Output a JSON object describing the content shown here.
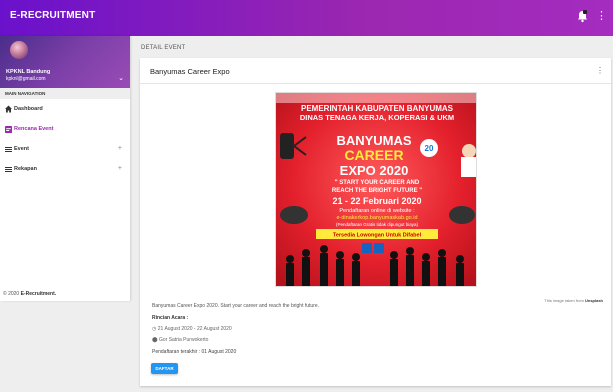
{
  "app": {
    "title": "E-RECRUITMENT"
  },
  "topbar": {
    "notification_icon": "bell-icon",
    "menu_icon": "kebab-icon"
  },
  "sidebar": {
    "user": {
      "name": "KPKNL Bandung",
      "email": "kpknl@gmail.com"
    },
    "nav_header": "MAIN NAVIGATION",
    "items": [
      {
        "label": "Dashboard",
        "icon": "home-icon",
        "active": false
      },
      {
        "label": "Rencana Event",
        "icon": "calendar-icon",
        "active": true
      },
      {
        "label": "Event",
        "icon": "list-icon",
        "expand": "+"
      },
      {
        "label": "Rekapan",
        "icon": "list-icon",
        "expand": "+"
      }
    ],
    "footer": {
      "year_text": "© 2020",
      "brand": "E-Recruitment."
    }
  },
  "breadcrumb": "DETAIL EVENT",
  "event": {
    "title": "Banyumas Career Expo",
    "poster": {
      "line1": "PEMERINTAH KABUPATEN BANYUMAS",
      "line2": "DINAS TENAGA KERJA, KOPERASI & UKM",
      "headline1": "BANYUMAS",
      "headline2": "CAREER",
      "headline3": "EXPO 2020",
      "tagline1": "\" START YOUR CAREER AND",
      "tagline2": "REACH THE BRIGHT FUTURE \"",
      "dates": "21 - 22 Februari 2020",
      "reg1": "Pendaftaran online di website :",
      "reg2": "e-dinakerkop.banyumaskab.go.id",
      "reg3": "(Pendaftaran Gratis tidak dipungut biaya)",
      "banner": "Tersedia Lowongan Untuk Difabel",
      "badge": "20"
    },
    "image_credit_prefix": "This image taken from ",
    "image_credit_source": "Unsplash",
    "description": "Banyumas Career Expo 2020. Start your career and reach the bright future.",
    "rincian_label": "Rincian Acara :",
    "date_range": "21 August 2020 - 22 August 2020",
    "location": "Gor Satria Purwokerto",
    "deadline": "Pendaftaran terakhir : 01 August 2020",
    "button": "DAFTAR"
  },
  "colors": {
    "primary": "#9c27b0",
    "button": "#2196f3",
    "poster_bg": "#e8252f"
  }
}
